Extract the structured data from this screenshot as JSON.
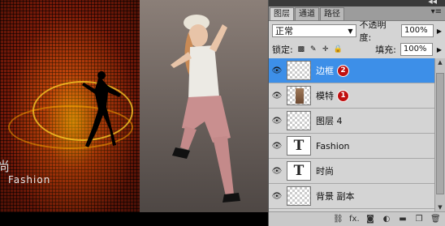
{
  "canvas": {
    "shishang_text": "尚",
    "fashion_text": "Fashion"
  },
  "panel": {
    "header_arrows": "◀◀",
    "tabs": [
      "图层",
      "通道",
      "路径"
    ],
    "tab_menu": "▾≡",
    "blend_mode": "正常",
    "opacity_label": "不透明度:",
    "opacity_value": "100%",
    "lock_label": "锁定:",
    "fill_label": "填充:",
    "fill_value": "100%",
    "layers": [
      {
        "name": "边框",
        "thumb": "checker",
        "badge": "2",
        "selected": true
      },
      {
        "name": "模特",
        "thumb": "model",
        "badge": "1",
        "selected": false
      },
      {
        "name": "图层 4",
        "thumb": "checker",
        "badge": "",
        "selected": false
      },
      {
        "name": "Fashion",
        "thumb": "T",
        "badge": "",
        "selected": false
      },
      {
        "name": "时尚",
        "thumb": "T",
        "badge": "",
        "selected": false
      },
      {
        "name": "背景 副本",
        "thumb": "checker",
        "badge": "",
        "selected": false
      }
    ],
    "footer_icons": [
      "link-icon",
      "fx-icon",
      "mask-icon",
      "adjustment-icon",
      "group-icon",
      "new-layer-icon",
      "trash-icon"
    ],
    "footer_fx": "fx."
  }
}
